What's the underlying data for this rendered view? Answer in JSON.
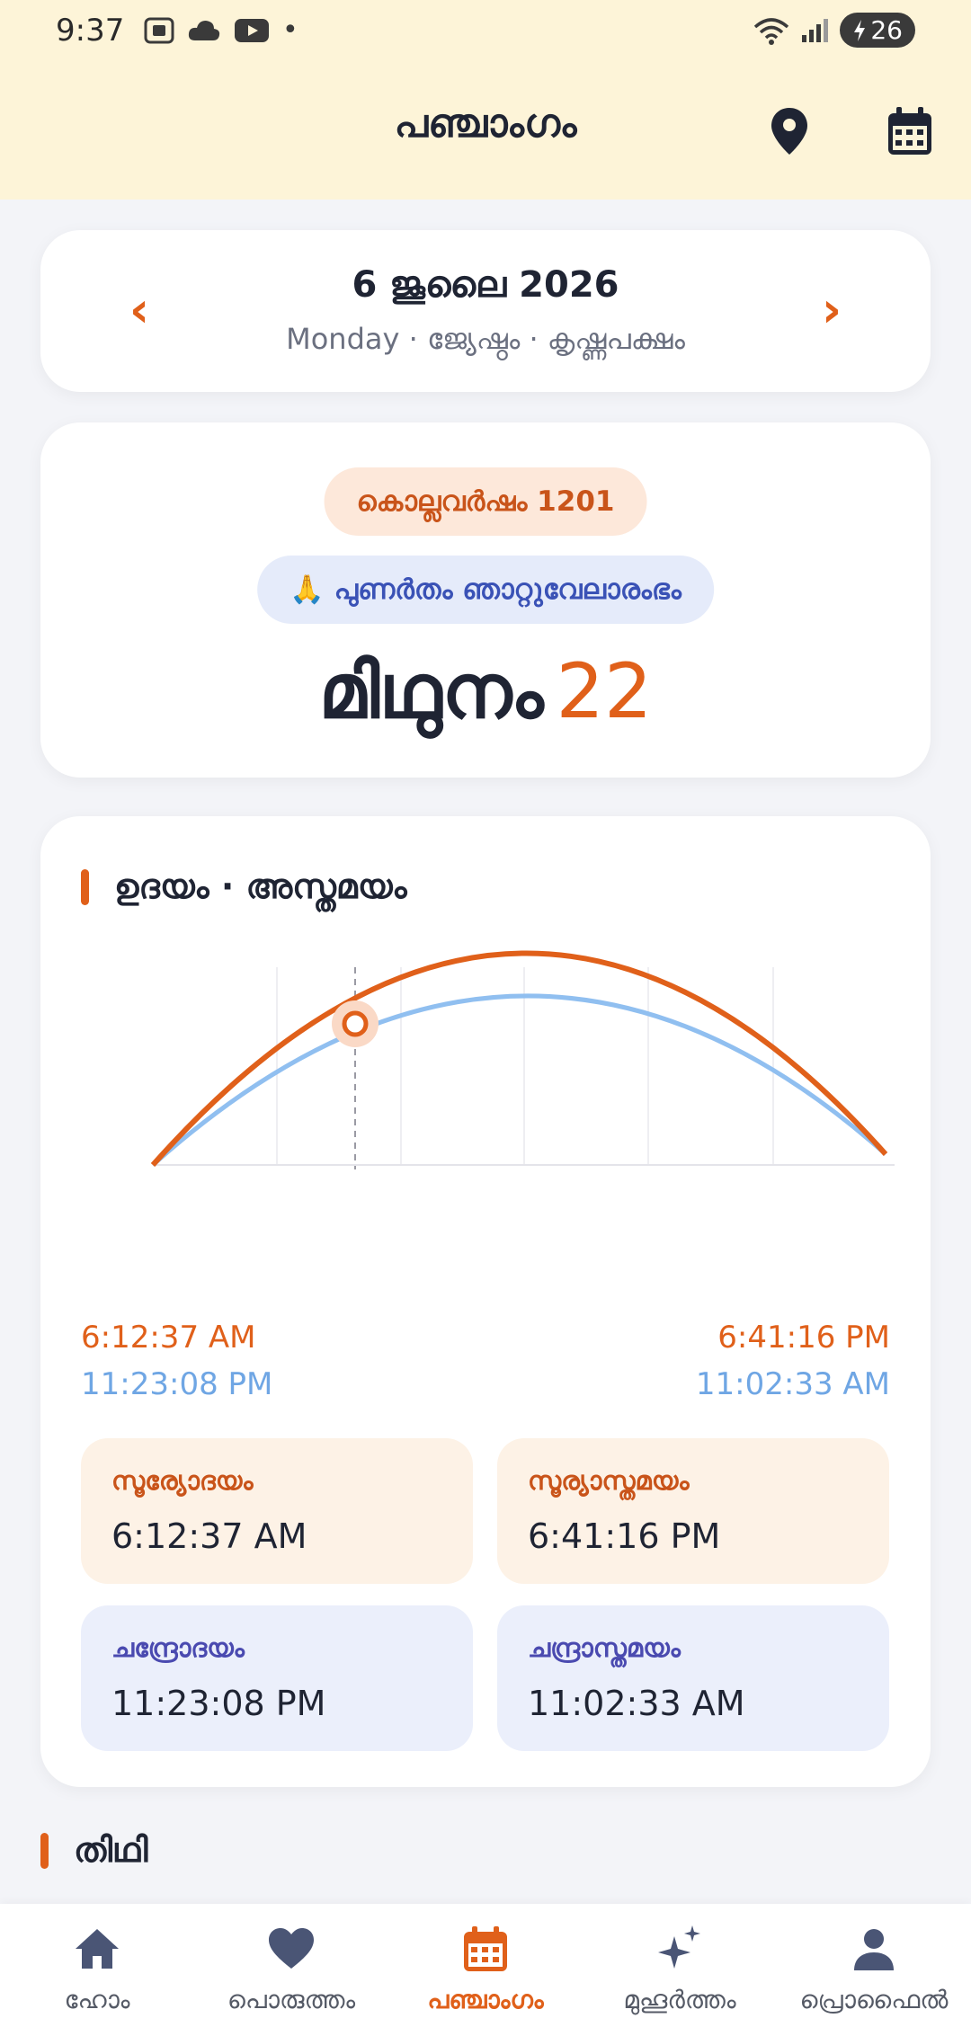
{
  "status_bar": {
    "time": "9:37",
    "battery": "26",
    "dot": "•"
  },
  "header": {
    "title": "പഞ്ചാംഗം",
    "icons": [
      "location-pin-icon",
      "calendar-icon"
    ]
  },
  "date_nav": {
    "date": "6 ജൂലൈ 2026",
    "subtitle": "Monday · ജ്യേഷ്ഠം · കൃഷ്ണപക്ഷം",
    "prev_glyph": "‹",
    "next_glyph": "›"
  },
  "year_card": {
    "kollavarsham": "കൊല്ലവർഷം 1201",
    "njattuvela": "🙏 പുണർതം ഞാറ്റുവേലാരംഭം",
    "month": "മിഥുനം",
    "day": "22"
  },
  "rise_set": {
    "title": "ഉദയം · അസ്തമയം",
    "left_sun_time": "6:12:37 AM",
    "left_moon_time": "11:23:08 PM",
    "right_sun_time": "6:41:16 PM",
    "right_moon_time": "11:02:33 AM",
    "tiles": {
      "sunrise_label": "സൂര്യോദയം",
      "sunrise_value": "6:12:37 AM",
      "sunset_label": "സൂര്യാസ്തമയം",
      "sunset_value": "6:41:16 PM",
      "moonrise_label": "ചന്ദ്രോദയം",
      "moonrise_value": "11:23:08 PM",
      "moonset_label": "ചന്ദ്രാസ്തമയം",
      "moonset_value": "11:02:33 AM"
    },
    "colors": {
      "sun": "#e0601a",
      "moon": "#90bff0"
    }
  },
  "tithi": {
    "title": "തിഥി"
  },
  "bottom_nav": {
    "items": [
      {
        "label": "ഹോം",
        "icon": "home-icon"
      },
      {
        "label": "പൊരുത്തം",
        "icon": "heart-icon"
      },
      {
        "label": "പഞ്ചാംഗം",
        "icon": "calendar-icon"
      },
      {
        "label": "മുഹൂർത്തം",
        "icon": "sparkle-icon"
      },
      {
        "label": "പ്രൊഫൈൽ",
        "icon": "profile-icon"
      }
    ],
    "active_index": 2
  }
}
